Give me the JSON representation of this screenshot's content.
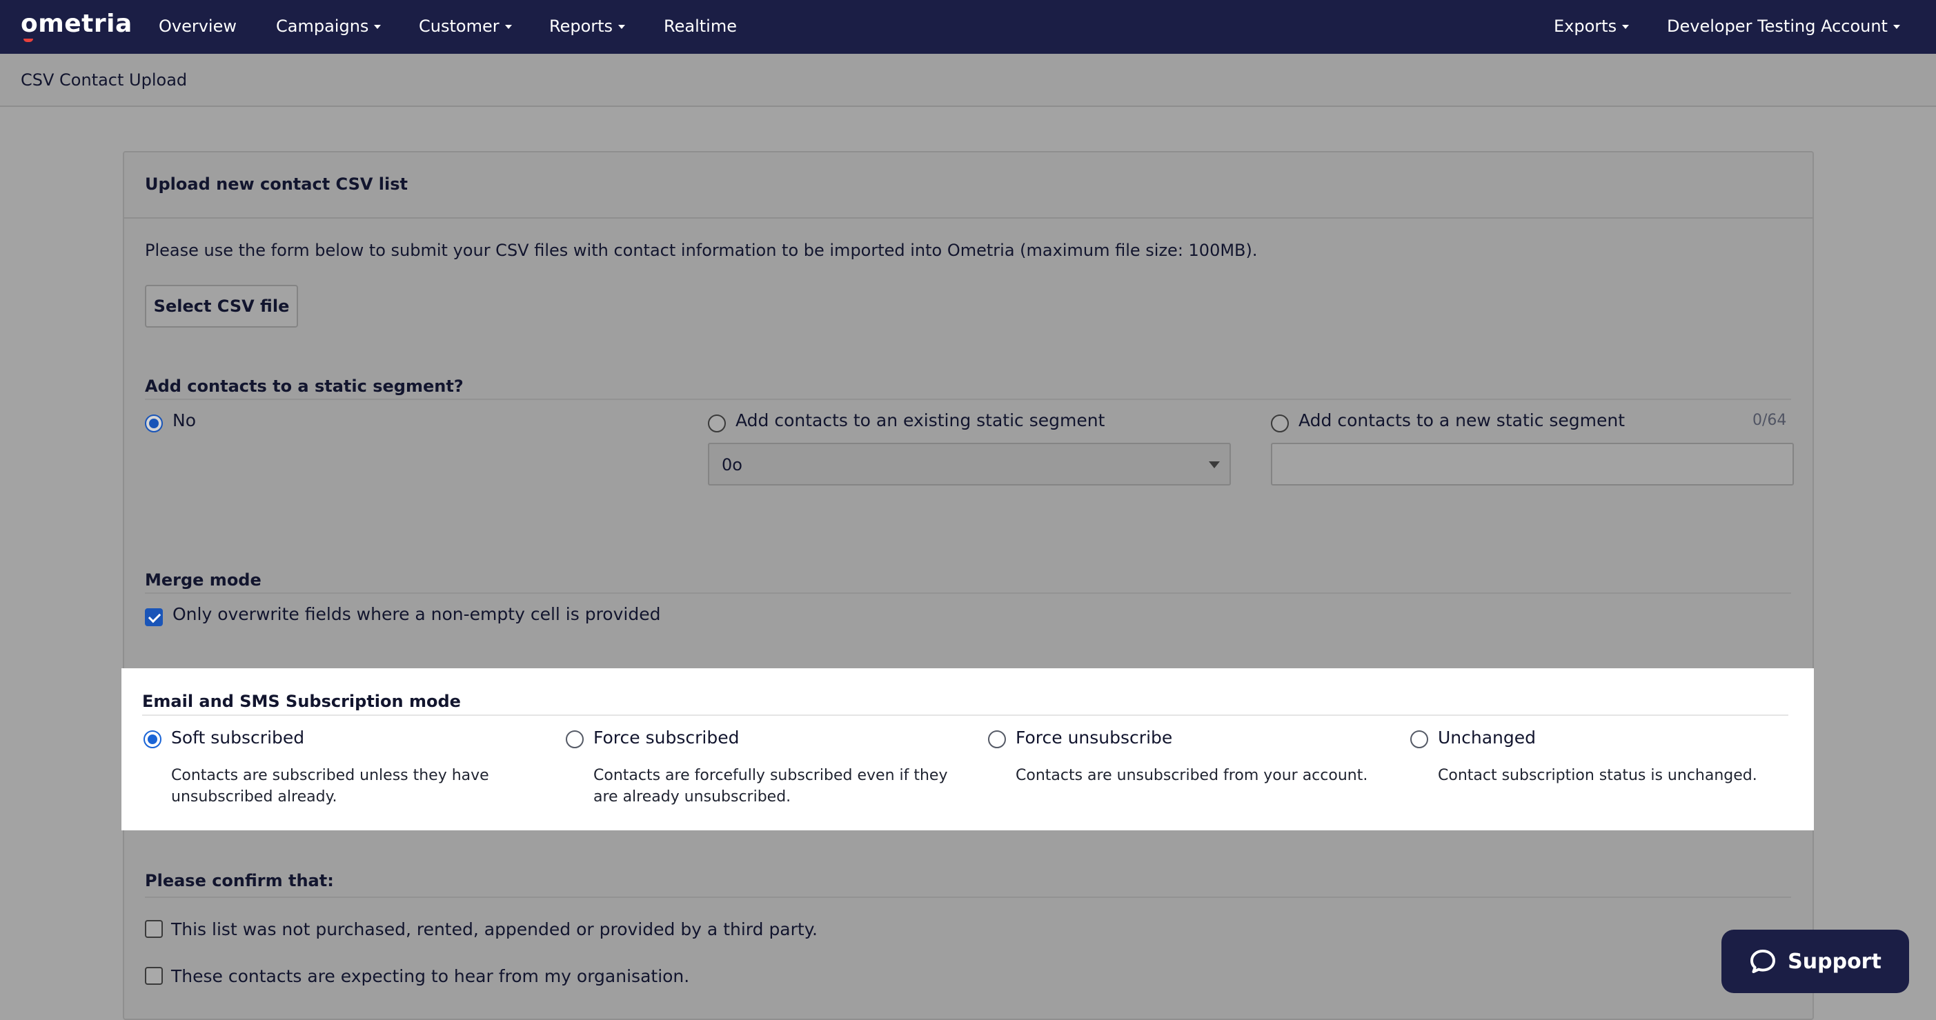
{
  "nav": {
    "logo": "ometria",
    "items": [
      {
        "label": "Overview",
        "dropdown": false
      },
      {
        "label": "Campaigns",
        "dropdown": true
      },
      {
        "label": "Customer",
        "dropdown": true
      },
      {
        "label": "Reports",
        "dropdown": true
      },
      {
        "label": "Realtime",
        "dropdown": false
      }
    ],
    "right_items": [
      {
        "label": "Exports",
        "dropdown": true
      },
      {
        "label": "Developer Testing Account",
        "dropdown": true
      }
    ]
  },
  "subheader": {
    "title": "CSV Contact Upload"
  },
  "card": {
    "title": "Upload new contact CSV list",
    "intro": "Please use the form below to submit your CSV files with contact information to be imported into Ometria (maximum file size: 100MB).",
    "select_button": "Select CSV file"
  },
  "segment": {
    "title": "Add contacts to a static segment?",
    "options": [
      {
        "label": "No",
        "checked": true
      },
      {
        "label": "Add contacts to an existing static segment",
        "checked": false
      },
      {
        "label": "Add contacts to a new static segment",
        "checked": false
      }
    ],
    "select_value": "0o",
    "counter": "0/64",
    "new_segment_value": ""
  },
  "merge": {
    "title": "Merge mode",
    "checkbox_label": "Only overwrite fields where a non-empty cell is provided",
    "checked": true
  },
  "subscription": {
    "title": "Email and SMS Subscription mode",
    "options": [
      {
        "label": "Soft subscribed",
        "desc": "Contacts are subscribed unless they have unsubscribed already.",
        "checked": true
      },
      {
        "label": "Force subscribed",
        "desc": "Contacts are forcefully subscribed even if they are already unsubscribed.",
        "checked": false
      },
      {
        "label": "Force unsubscribe",
        "desc": "Contacts are unsubscribed from your account.",
        "checked": false
      },
      {
        "label": "Unchanged",
        "desc": "Contact subscription status is unchanged.",
        "checked": false
      }
    ]
  },
  "confirm": {
    "title": "Please confirm that:",
    "items": [
      {
        "label": "This list was not purchased, rented, appended or provided by a third party.",
        "checked": false
      },
      {
        "label": "These contacts are expecting to hear from my organisation.",
        "checked": false
      }
    ]
  },
  "support": {
    "label": "Support",
    "icon": "chat-bubble-icon"
  },
  "colors": {
    "nav_bg": "#1b1e45",
    "accent": "#1a64d6",
    "overlay": "#a3a3a3",
    "panel": "#ffffff"
  }
}
